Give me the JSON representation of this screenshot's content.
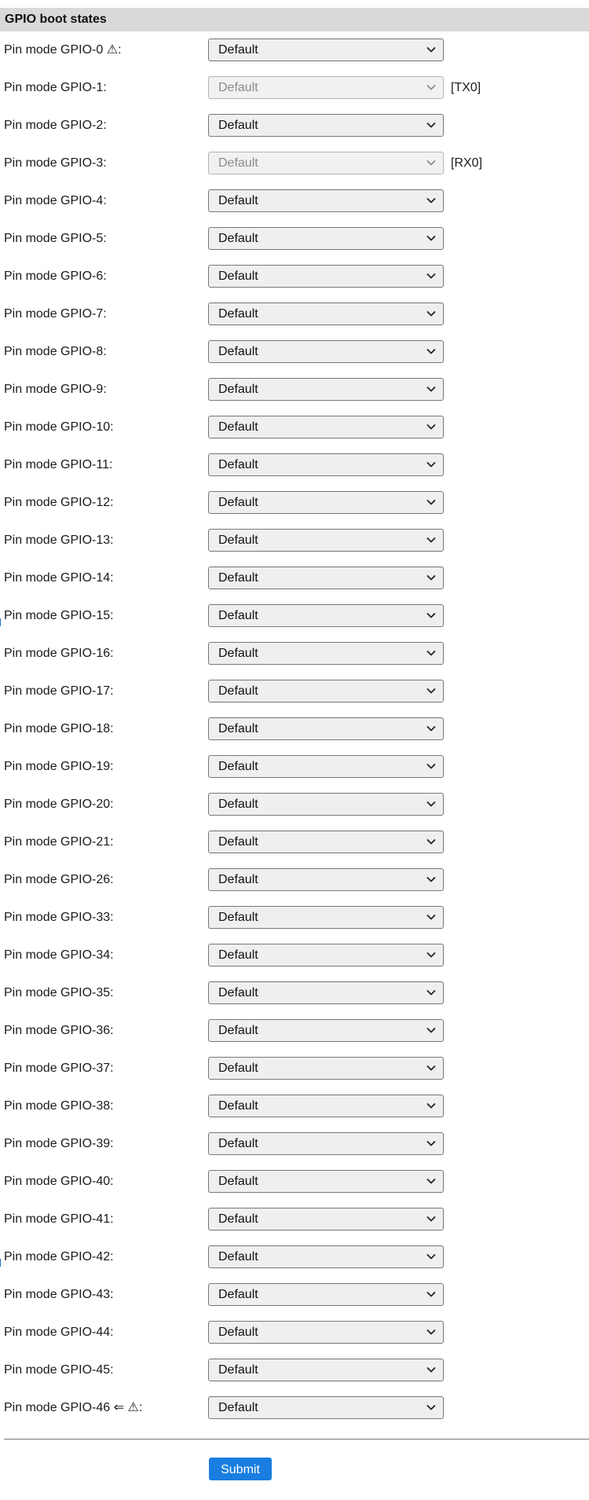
{
  "section": {
    "title": "GPIO boot states"
  },
  "pins": [
    {
      "label": "Pin mode GPIO-0 ⚠:",
      "value": "Default",
      "disabled": false,
      "note": ""
    },
    {
      "label": "Pin mode GPIO-1:",
      "value": "Default",
      "disabled": true,
      "note": "[TX0]"
    },
    {
      "label": "Pin mode GPIO-2:",
      "value": "Default",
      "disabled": false,
      "note": ""
    },
    {
      "label": "Pin mode GPIO-3:",
      "value": "Default",
      "disabled": true,
      "note": "[RX0]"
    },
    {
      "label": "Pin mode GPIO-4:",
      "value": "Default",
      "disabled": false,
      "note": ""
    },
    {
      "label": "Pin mode GPIO-5:",
      "value": "Default",
      "disabled": false,
      "note": ""
    },
    {
      "label": "Pin mode GPIO-6:",
      "value": "Default",
      "disabled": false,
      "note": ""
    },
    {
      "label": "Pin mode GPIO-7:",
      "value": "Default",
      "disabled": false,
      "note": ""
    },
    {
      "label": "Pin mode GPIO-8:",
      "value": "Default",
      "disabled": false,
      "note": ""
    },
    {
      "label": "Pin mode GPIO-9:",
      "value": "Default",
      "disabled": false,
      "note": ""
    },
    {
      "label": "Pin mode GPIO-10:",
      "value": "Default",
      "disabled": false,
      "note": ""
    },
    {
      "label": "Pin mode GPIO-11:",
      "value": "Default",
      "disabled": false,
      "note": ""
    },
    {
      "label": "Pin mode GPIO-12:",
      "value": "Default",
      "disabled": false,
      "note": ""
    },
    {
      "label": "Pin mode GPIO-13:",
      "value": "Default",
      "disabled": false,
      "note": ""
    },
    {
      "label": "Pin mode GPIO-14:",
      "value": "Default",
      "disabled": false,
      "note": ""
    },
    {
      "label": "Pin mode GPIO-15:",
      "value": "Default",
      "disabled": false,
      "note": ""
    },
    {
      "label": "Pin mode GPIO-16:",
      "value": "Default",
      "disabled": false,
      "note": ""
    },
    {
      "label": "Pin mode GPIO-17:",
      "value": "Default",
      "disabled": false,
      "note": ""
    },
    {
      "label": "Pin mode GPIO-18:",
      "value": "Default",
      "disabled": false,
      "note": ""
    },
    {
      "label": "Pin mode GPIO-19:",
      "value": "Default",
      "disabled": false,
      "note": ""
    },
    {
      "label": "Pin mode GPIO-20:",
      "value": "Default",
      "disabled": false,
      "note": ""
    },
    {
      "label": "Pin mode GPIO-21:",
      "value": "Default",
      "disabled": false,
      "note": ""
    },
    {
      "label": "Pin mode GPIO-26:",
      "value": "Default",
      "disabled": false,
      "note": ""
    },
    {
      "label": "Pin mode GPIO-33:",
      "value": "Default",
      "disabled": false,
      "note": ""
    },
    {
      "label": "Pin mode GPIO-34:",
      "value": "Default",
      "disabled": false,
      "note": ""
    },
    {
      "label": "Pin mode GPIO-35:",
      "value": "Default",
      "disabled": false,
      "note": ""
    },
    {
      "label": "Pin mode GPIO-36:",
      "value": "Default",
      "disabled": false,
      "note": ""
    },
    {
      "label": "Pin mode GPIO-37:",
      "value": "Default",
      "disabled": false,
      "note": ""
    },
    {
      "label": "Pin mode GPIO-38:",
      "value": "Default",
      "disabled": false,
      "note": ""
    },
    {
      "label": "Pin mode GPIO-39:",
      "value": "Default",
      "disabled": false,
      "note": ""
    },
    {
      "label": "Pin mode GPIO-40:",
      "value": "Default",
      "disabled": false,
      "note": ""
    },
    {
      "label": "Pin mode GPIO-41:",
      "value": "Default",
      "disabled": false,
      "note": ""
    },
    {
      "label": "Pin mode GPIO-42:",
      "value": "Default",
      "disabled": false,
      "note": ""
    },
    {
      "label": "Pin mode GPIO-43:",
      "value": "Default",
      "disabled": false,
      "note": ""
    },
    {
      "label": "Pin mode GPIO-44:",
      "value": "Default",
      "disabled": false,
      "note": ""
    },
    {
      "label": "Pin mode GPIO-45:",
      "value": "Default",
      "disabled": false,
      "note": ""
    },
    {
      "label": "Pin mode GPIO-46 ⇐ ⚠:",
      "value": "Default",
      "disabled": false,
      "note": ""
    }
  ],
  "form": {
    "submit_label": "Submit"
  },
  "colors": {
    "header_bg": "#d9d9d9",
    "select_bg": "#efefef",
    "select_disabled_text": "#8a8a8a",
    "submit_bg": "#1a7ee0",
    "submit_text": "#ffffff",
    "divider": "#777777"
  },
  "icons": {
    "select_indicator": "chevron-down-icon",
    "warning": "warning-icon",
    "arrow": "left-double-arrow-icon"
  }
}
